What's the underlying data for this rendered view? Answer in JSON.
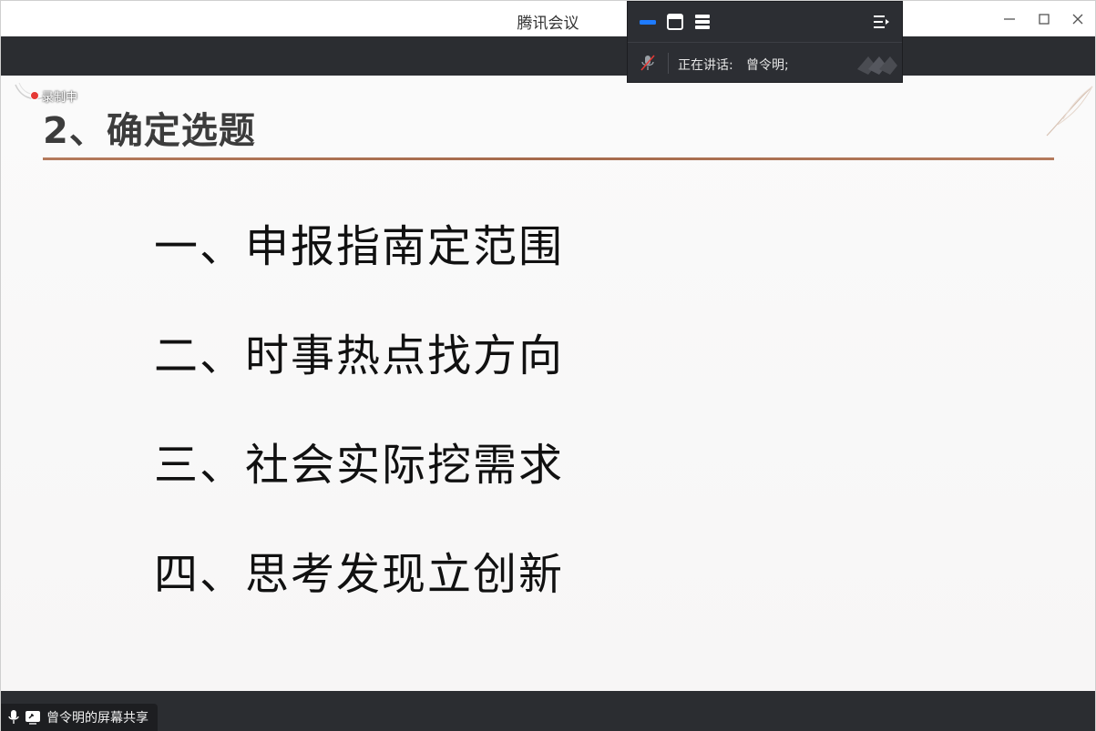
{
  "window": {
    "title": "腾讯会议"
  },
  "slide": {
    "title": "2、确定选题",
    "items": [
      "一、申报指南定范围",
      "二、时事热点找方向",
      "三、社会实际挖需求",
      "四、思考发现立创新"
    ]
  },
  "recording": {
    "label": "录制中"
  },
  "speaker_panel": {
    "speaking_label": "正在讲话:",
    "speaker_name": "曾令明;"
  },
  "share": {
    "label": "曾令明的屏幕共享"
  },
  "icons": {
    "minimize": "minimize-icon",
    "maximize": "maximize-icon",
    "close": "close-icon",
    "gallery_view": "gallery-view-icon",
    "window_view": "window-view-icon",
    "list_view": "list-view-icon",
    "menu": "menu-icon",
    "mic_muted": "mic-muted-icon",
    "screen_share": "screen-share-icon",
    "mic": "mic-icon"
  },
  "colors": {
    "accent_blue": "#1e7bff",
    "record_red": "#e53935",
    "rule_brown": "#a56a4b",
    "dark_band": "#2b2d31"
  }
}
